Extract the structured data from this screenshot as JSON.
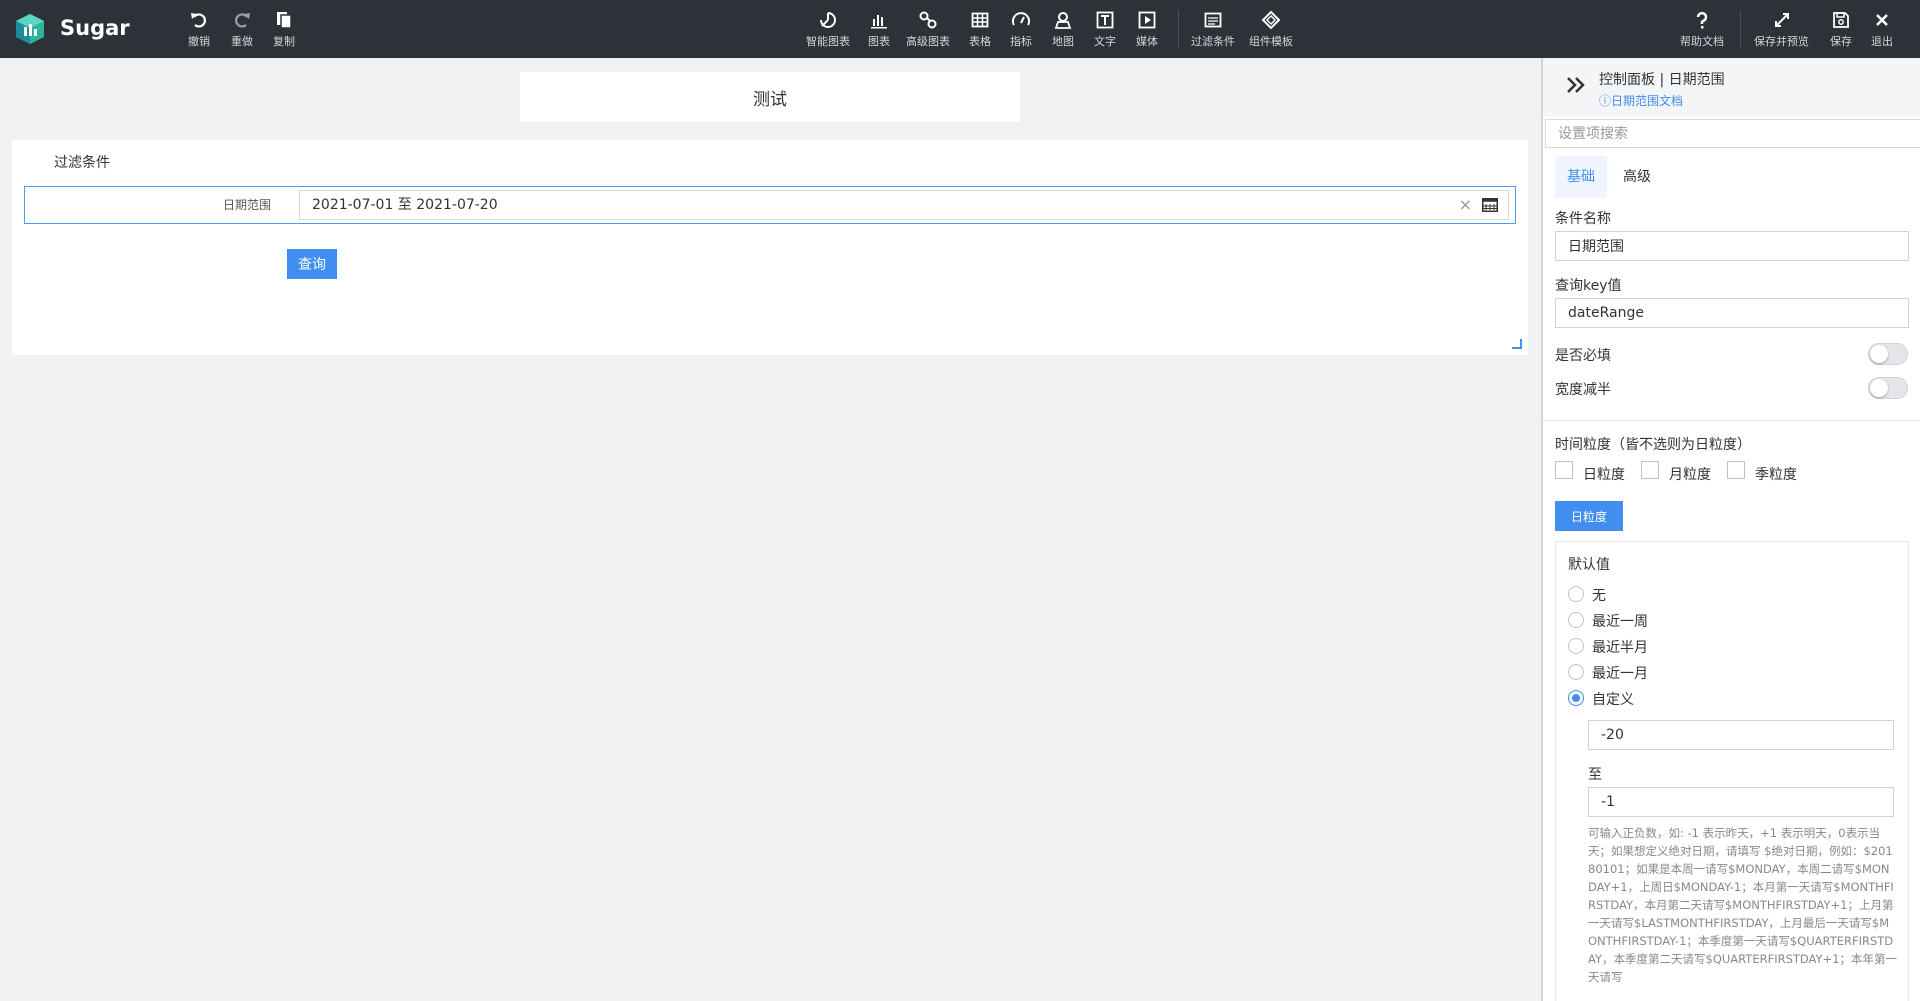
{
  "app": {
    "name": "Sugar"
  },
  "toolbar": {
    "left": [
      {
        "id": "undo",
        "label": "撤销",
        "icon": "undo-icon"
      },
      {
        "id": "redo",
        "label": "重做",
        "icon": "redo-icon"
      },
      {
        "id": "copy",
        "label": "复制",
        "icon": "copy-icon"
      }
    ],
    "center": [
      {
        "id": "smart-chart",
        "label": "智能图表",
        "icon": "smart-chart-icon"
      },
      {
        "id": "chart",
        "label": "图表",
        "icon": "bar-chart-icon"
      },
      {
        "id": "advanced-chart",
        "label": "高级图表",
        "icon": "advanced-chart-icon"
      },
      {
        "id": "table",
        "label": "表格",
        "icon": "table-icon"
      },
      {
        "id": "indicator",
        "label": "指标",
        "icon": "gauge-icon"
      },
      {
        "id": "map",
        "label": "地图",
        "icon": "map-pin-icon"
      },
      {
        "id": "text",
        "label": "文字",
        "icon": "text-icon"
      },
      {
        "id": "media",
        "label": "媒体",
        "icon": "media-play-icon"
      },
      {
        "id": "filter",
        "label": "过滤条件",
        "icon": "filter-icon"
      },
      {
        "id": "component-template",
        "label": "组件模板",
        "icon": "template-icon"
      }
    ],
    "right": [
      {
        "id": "help",
        "label": "帮助文档",
        "icon": "question-icon"
      },
      {
        "id": "save-preview",
        "label": "保存并预览",
        "icon": "expand-icon"
      },
      {
        "id": "save",
        "label": "保存",
        "icon": "save-icon"
      },
      {
        "id": "exit",
        "label": "退出",
        "icon": "close-icon"
      }
    ]
  },
  "canvas": {
    "title": "测试",
    "filter_card": {
      "title": "过滤条件",
      "row_label": "日期范围",
      "date_value": "2021-07-01 至 2021-07-20",
      "clear_glyph": "×",
      "query_label": "查询"
    }
  },
  "panel": {
    "title": "控制面板 | 日期范围",
    "doc_link": "日期范围文档",
    "search_placeholder": "设置项搜索",
    "tabs": [
      {
        "label": "基础",
        "active": true
      },
      {
        "label": "高级",
        "active": false
      }
    ],
    "condition_name_label": "条件名称",
    "condition_name_value": "日期范围",
    "query_key_label": "查询key值",
    "query_key_value": "dateRange",
    "required_label": "是否必填",
    "required_on": false,
    "half_width_label": "宽度减半",
    "half_width_on": false,
    "granularity_label": "时间粒度（皆不选则为日粒度）",
    "granularity_options": [
      {
        "label": "日粒度",
        "checked": false
      },
      {
        "label": "月粒度",
        "checked": false
      },
      {
        "label": "季粒度",
        "checked": false
      }
    ],
    "granularity_button": "日粒度",
    "default_label": "默认值",
    "default_options": [
      {
        "label": "无",
        "checked": false
      },
      {
        "label": "最近一周",
        "checked": false
      },
      {
        "label": "最近半月",
        "checked": false
      },
      {
        "label": "最近一月",
        "checked": false
      },
      {
        "label": "自定义",
        "checked": true
      }
    ],
    "custom_start": "-20",
    "to_label": "至",
    "custom_end": "-1",
    "help_text": "可输入正负数，如: -1 表示昨天，+1 表示明天，0表示当天；如果想定义绝对日期，请填写 $绝对日期，例如：$20180101；如果是本周一请写$MONDAY，本周二请写$MONDAY+1，上周日$MONDAY-1；本月第一天请写$MONTHFIRSTDAY，本月第二天请写$MONTHFIRSTDAY+1；上月第一天请写$LASTMONTHFIRSTDAY，上月最后一天请写$MONTHFIRSTDAY-1；本季度第一天请写$QUARTERFIRSTDAY，本季度第二天请写$QUARTERFIRSTDAY+1；本年第一天请写"
  },
  "colors": {
    "topbar": "#2d3238",
    "accent": "#3f8ef0",
    "canvas_bg": "#f0f1f3"
  }
}
